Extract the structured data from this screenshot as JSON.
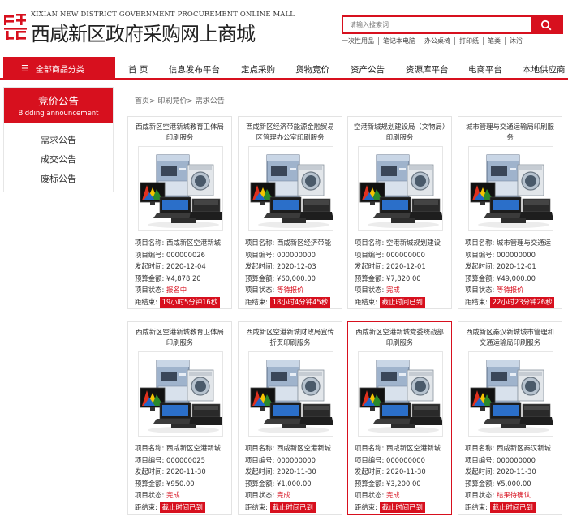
{
  "header": {
    "logo_en": "XIXIAN NEW DISTRICT GOVERNMENT PROCUREMENT ONLINE MALL",
    "logo_cn": "西咸新区政府采购网上商城",
    "search_placeholder": "请输入搜索词",
    "hotwords": [
      "一次性用品",
      "笔记本电脑",
      "办公桌椅",
      "打印纸",
      "笔类",
      "沐浴"
    ]
  },
  "nav": {
    "category_label": "全部商品分类",
    "items": [
      "首 页",
      "信息发布平台",
      "定点采购",
      "货物竞价",
      "资产公告",
      "资源库平台",
      "电商平台",
      "本地供应商"
    ]
  },
  "sidebar": {
    "title": "竞价公告",
    "subtitle": "Bidding announcement",
    "links": [
      "需求公告",
      "成交公告",
      "废标公告"
    ]
  },
  "breadcrumb": "首页> 印刷竞价> 需求公告",
  "labels": {
    "name": "项目名称: ",
    "code": "项目编号: ",
    "date": "发起时间: ",
    "budget": "预算金额: ",
    "status": "项目状态: ",
    "countdown": "距结束: "
  },
  "cards": [
    {
      "title": "西咸新区空港新城教育卫体局印刷服务",
      "name": "西咸新区空港新城",
      "code": "000000026",
      "date": "2020-12-04",
      "budget": "¥4,878.20",
      "status": "报名中",
      "countdown": "19小时5分钟16秒"
    },
    {
      "title": "西咸新区经济带能源金融贸易区管理办公室印刷服务",
      "name": "西咸新区经济带能",
      "code": "000000000",
      "date": "2020-12-03",
      "budget": "¥60,000.00",
      "status": "等待报价",
      "countdown": "18小时4分钟45秒"
    },
    {
      "title": "空港新城规划建设局（文物局）印刷服务",
      "name": "空港新城规划建设",
      "code": "000000000",
      "date": "2020-12-01",
      "budget": "¥7,820.00",
      "status": "完成",
      "countdown": "截止时间已到"
    },
    {
      "title": "城市管理与交通运输局印刷服务",
      "name": "城市管理与交通运",
      "code": "000000000",
      "date": "2020-12-01",
      "budget": "¥49,000.00",
      "status": "等待报价",
      "countdown": "22小时23分钟26秒"
    },
    {
      "title": "西咸新区空港新城教育卫体局印刷服务",
      "name": "西咸新区空港新城",
      "code": "000000025",
      "date": "2020-11-30",
      "budget": "¥950.00",
      "status": "完成",
      "countdown": "截止时间已到"
    },
    {
      "title": "西咸新区空港新城财政局宣传折页印刷服务",
      "name": "西咸新区空港新城",
      "code": "000000000",
      "date": "2020-11-30",
      "budget": "¥1,000.00",
      "status": "完成",
      "countdown": "截止时间已到"
    },
    {
      "title": "西咸新区空港新城党委统战部印刷服务",
      "name": "西咸新区空港新城",
      "code": "000000000",
      "date": "2020-11-30",
      "budget": "¥3,200.00",
      "status": "完成",
      "countdown": "截止时间已到"
    },
    {
      "title": "西咸新区秦汉新城城市管理和交通运输局印刷服务",
      "name": "西咸新区秦汉新城",
      "code": "000000000",
      "date": "2020-11-30",
      "budget": "¥5,000.00",
      "status": "结果待确认",
      "countdown": "截止时间已到"
    }
  ],
  "colors": {
    "brand_red": "#d7101e"
  }
}
